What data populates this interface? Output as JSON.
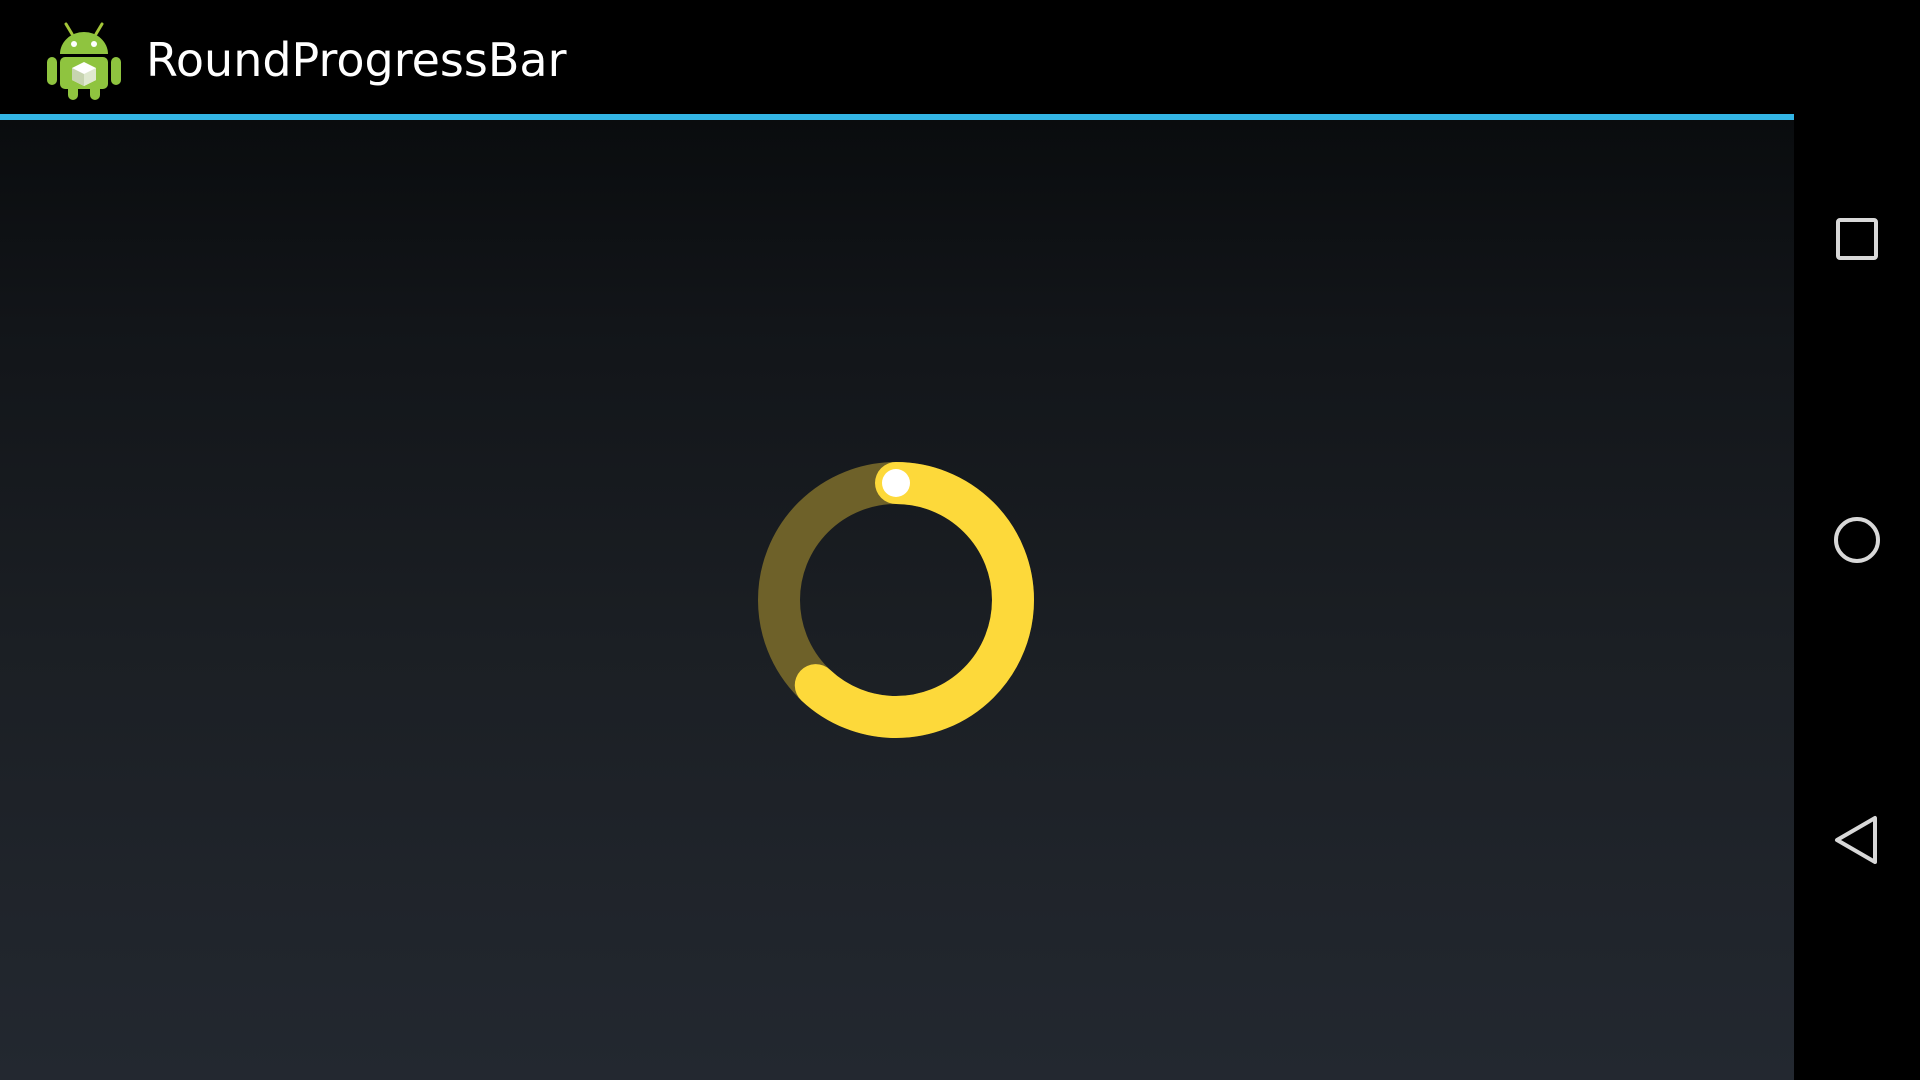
{
  "action_bar": {
    "title": "RoundProgressBar",
    "accent_color": "#33b5e5",
    "icon": "android-robot-icon"
  },
  "progress": {
    "value": 0.62,
    "track_color": "#6e6129",
    "progress_color": "#fdd93a",
    "thumb_color": "#ffffff"
  },
  "nav_bar": {
    "buttons": [
      {
        "name": "recents",
        "icon": "square-icon"
      },
      {
        "name": "home",
        "icon": "circle-icon"
      },
      {
        "name": "back",
        "icon": "triangle-back-icon"
      }
    ]
  }
}
